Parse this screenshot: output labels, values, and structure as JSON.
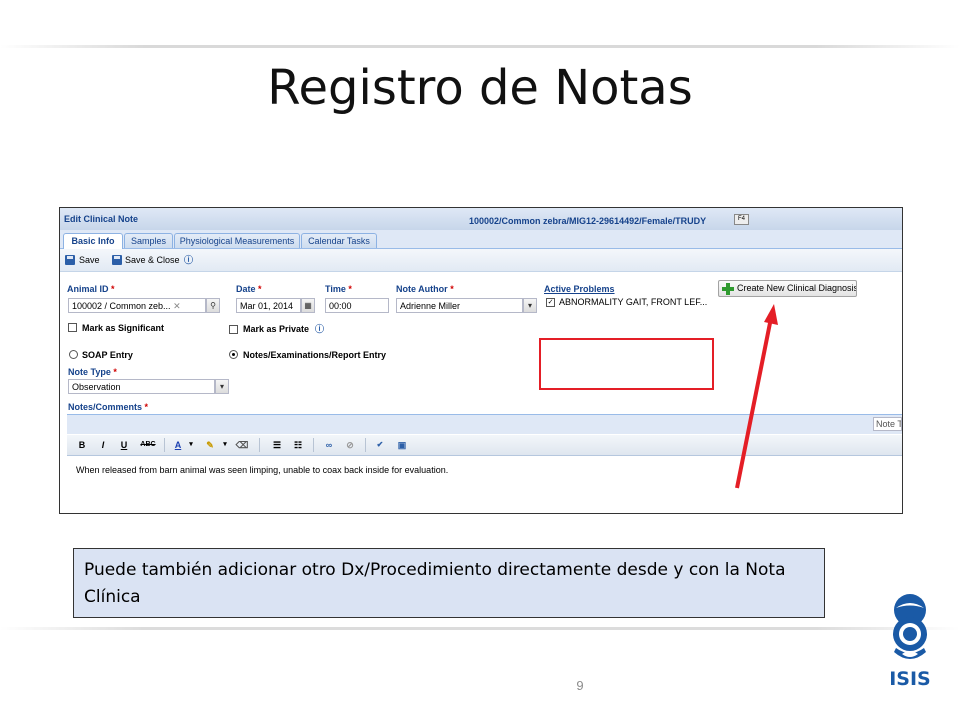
{
  "slide": {
    "title": "Registro de Notas",
    "callout": "Puede también adicionar otro Dx/Procedimiento directamente desde y con la Nota Clínica",
    "page_number": "9",
    "logo_text": "ISIS"
  },
  "window": {
    "title": "Edit Clinical Note",
    "record": "100002/Common zebra/MIG12-29614492/Female/TRUDY",
    "f4_badge": "F4"
  },
  "tabs": [
    "Basic Info",
    "Samples",
    "Physiological Measurements",
    "Calendar Tasks"
  ],
  "toolbar": {
    "save": "Save",
    "save_close": "Save & Close"
  },
  "form": {
    "animal_id_label": "Animal ID",
    "animal_id_value": "100002 / Common zeb...",
    "date_label": "Date",
    "date_value": "Mar 01, 2014",
    "time_label": "Time",
    "time_value": "00:00",
    "author_label": "Note Author",
    "author_value": "Adrienne Miller",
    "required_mark": "*",
    "mark_significant": "Mark as Significant",
    "mark_private": "Mark as Private",
    "soap_entry": "SOAP Entry",
    "notes_entry": "Notes/Examinations/Report Entry",
    "note_type_label": "Note Type",
    "note_type_value": "Observation",
    "notes_label": "Notes/Comments"
  },
  "active_problems": {
    "label": "Active Problems",
    "item": "ABNORMALITY GAIT, FRONT LEF...",
    "checked": true
  },
  "create_button": "Create New Clinical Diagnosis",
  "editor": {
    "note_field": "Note T",
    "bold": "B",
    "italic": "I",
    "underline": "U",
    "strike": "ABC",
    "font_color": "A",
    "text": "When released from barn animal was seen limping, unable to coax back inside for evaluation."
  },
  "colors": {
    "header_text": "#15428b",
    "highlight_border": "#e41e26",
    "arrow": "#e41e26",
    "callout_bg": "#dae3f3",
    "logo": "#1a5aa6"
  }
}
